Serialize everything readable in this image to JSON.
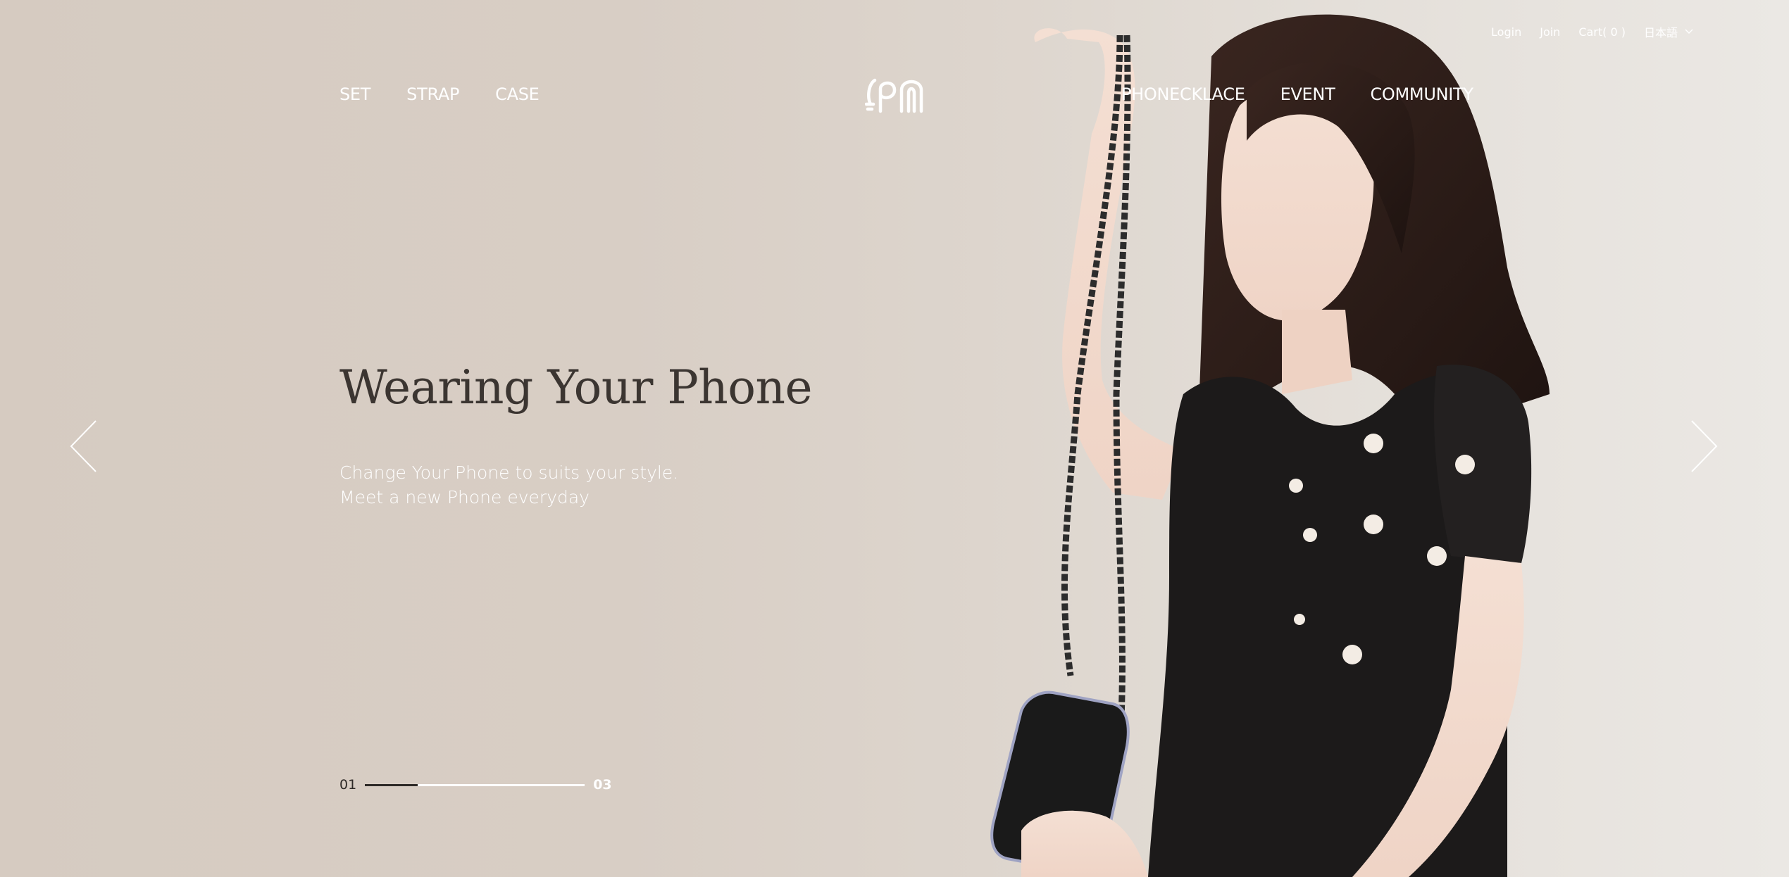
{
  "util": {
    "login": "Login",
    "join": "Join",
    "cart": "Cart( 0 )",
    "language": "日本語"
  },
  "nav": {
    "left": [
      "SET",
      "STRAP",
      "CASE"
    ],
    "right": [
      "PHONECKLACE",
      "EVENT",
      "COMMUNITY"
    ]
  },
  "hero": {
    "title": "Wearing Your Phone",
    "subtitle_line1": "Change Your Phone to suits your style.",
    "subtitle_line2": "Meet a new Phone everyday"
  },
  "pager": {
    "current": "01",
    "total": "03",
    "progress": 0.24
  },
  "icons": {
    "logo": "pn-logo-icon",
    "prev": "chevron-left-icon",
    "next": "chevron-right-icon",
    "caret": "chevron-down-icon"
  },
  "colors": {
    "background": "#d6ccc2",
    "title_text": "#3b3531",
    "nav_text": "#ffffff"
  }
}
